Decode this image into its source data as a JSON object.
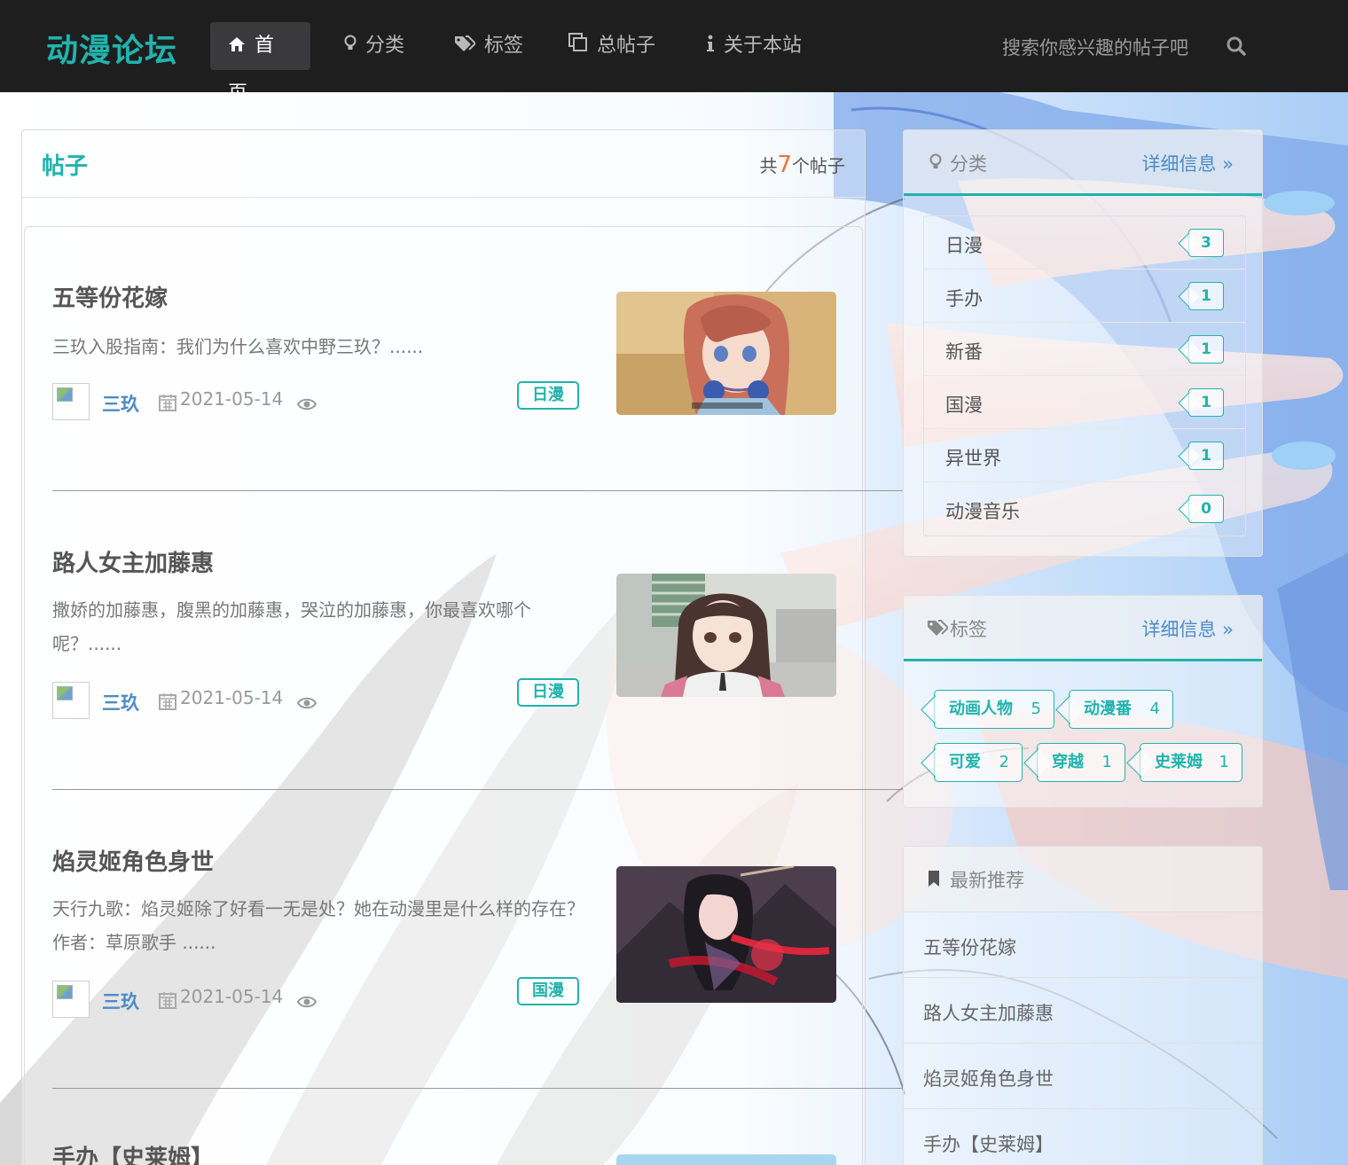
{
  "nav": {
    "brand": "动漫论坛",
    "items": [
      {
        "label": "首页",
        "icon": "home-icon",
        "active": true
      },
      {
        "label": "分类",
        "icon": "lightbulb-icon"
      },
      {
        "label": "标签",
        "icon": "tags-icon"
      },
      {
        "label": "总帖子",
        "icon": "copy-icon"
      },
      {
        "label": "关于本站",
        "icon": "info-icon"
      }
    ],
    "search_placeholder": "搜索你感兴趣的帖子吧",
    "search_icon": "search-icon"
  },
  "posts": {
    "title": "帖子",
    "count_prefix": "共",
    "count": "7",
    "count_suffix": "个帖子",
    "items": [
      {
        "title": "五等份花嫁",
        "excerpt": "三玖入股指南：我们为什么喜欢中野三玖？......",
        "author": "三玖",
        "date": "2021-05-14",
        "category": "日漫"
      },
      {
        "title": "路人女主加藤惠",
        "excerpt": "撒娇的加藤惠，腹黑的加藤惠，哭泣的加藤惠，你最喜欢哪个呢？......",
        "author": "三玖",
        "date": "2021-05-14",
        "category": "日漫"
      },
      {
        "title": "焰灵姬角色身世",
        "excerpt": "天行九歌：焰灵姬除了好看一无是处？她在动漫里是什么样的存在？ 作者：草原歌手 ......",
        "author": "三玖",
        "date": "2021-05-14",
        "category": "国漫"
      },
      {
        "title": "手办【史莱姆】"
      }
    ]
  },
  "categories": {
    "title": "分类",
    "link": "详细信息 »",
    "items": [
      {
        "name": "日漫",
        "count": "3"
      },
      {
        "name": "手办",
        "count": "1"
      },
      {
        "name": "新番",
        "count": "1"
      },
      {
        "name": "国漫",
        "count": "1"
      },
      {
        "name": "异世界",
        "count": "1"
      },
      {
        "name": "动漫音乐",
        "count": "0"
      }
    ]
  },
  "tags": {
    "title": "标签",
    "link": "详细信息 »",
    "items": [
      {
        "name": "动画人物",
        "count": "5"
      },
      {
        "name": "动漫番",
        "count": "4"
      },
      {
        "name": "可爱",
        "count": "2"
      },
      {
        "name": "穿越",
        "count": "1"
      },
      {
        "name": "史莱姆",
        "count": "1"
      }
    ]
  },
  "recommend": {
    "title": "最新推荐",
    "items": [
      "五等份花嫁",
      "路人女主加藤惠",
      "焰灵姬角色身世",
      "手办【史莱姆】"
    ]
  },
  "colors": {
    "accent": "#21b3ad",
    "link": "#4d8cc5",
    "count_highlight": "#f0703a",
    "navbar": "#1e1e1f"
  }
}
